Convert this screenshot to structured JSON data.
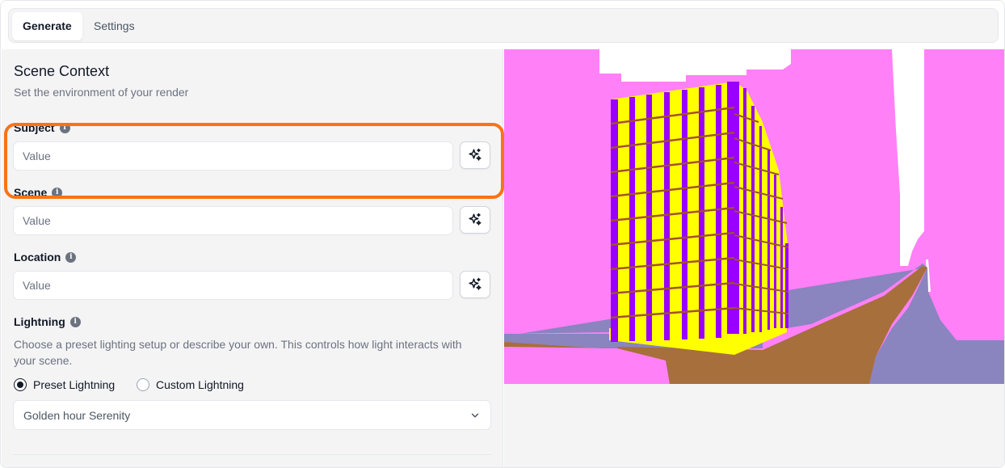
{
  "tabs": [
    {
      "label": "Generate",
      "active": true
    },
    {
      "label": "Settings",
      "active": false
    }
  ],
  "scene_context": {
    "title": "Scene Context",
    "subtitle": "Set the environment of your render"
  },
  "fields": {
    "subject": {
      "label": "Subject",
      "placeholder": "Value"
    },
    "scene": {
      "label": "Scene",
      "placeholder": "Value"
    },
    "location": {
      "label": "Location",
      "placeholder": "Value"
    }
  },
  "lighting": {
    "label": "Lightning",
    "description": "Choose a preset lighting setup or describe your own. This controls how light interacts with your scene.",
    "options": [
      {
        "label": "Preset Lightning",
        "checked": true
      },
      {
        "label": "Custom Lightning",
        "checked": false
      }
    ],
    "selected_value": "Golden hour Serenity"
  },
  "icons": {
    "info": "info-icon",
    "ai": "sparkles-icon",
    "dropdown": "chevron-down-icon"
  },
  "colors": {
    "highlight": "#f97316",
    "sky": "#ff80f7",
    "building_facade": "#ffff00",
    "building_frame": "#9900ff",
    "road": "#a66f3c",
    "sidewalk": "#8a84bf"
  }
}
